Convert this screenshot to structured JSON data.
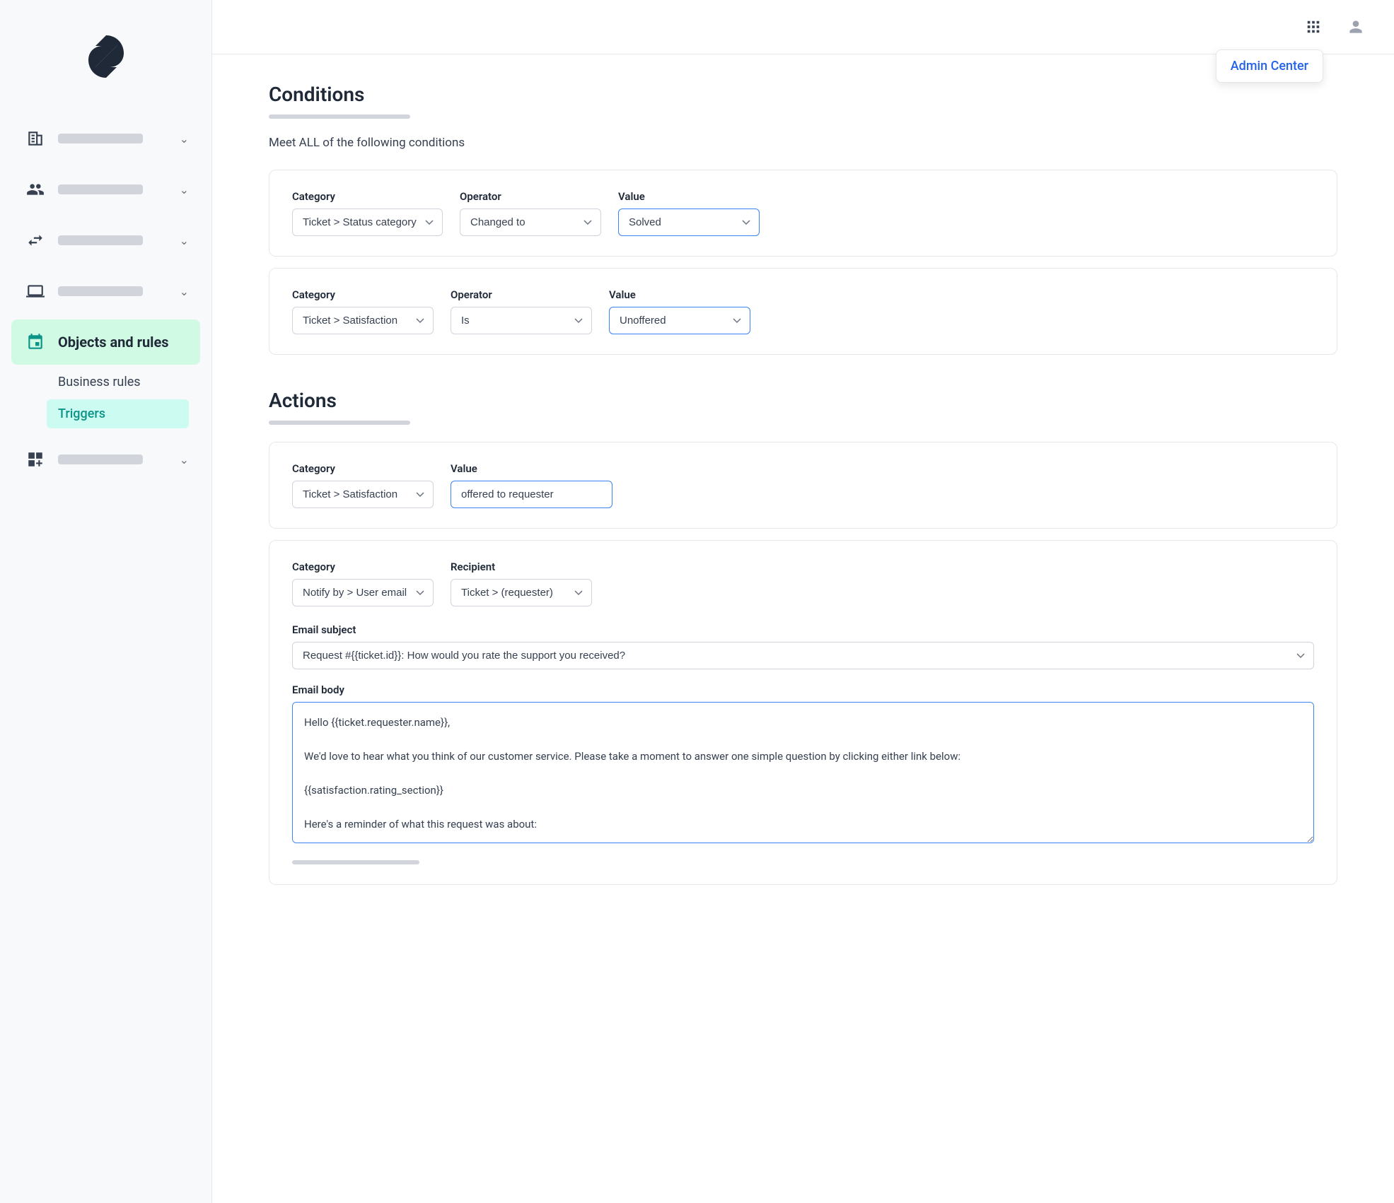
{
  "sidebar": {
    "logo_alt": "Zendesk",
    "nav_items": [
      {
        "id": "buildings",
        "label_bar": true,
        "active": false,
        "icon": "buildings"
      },
      {
        "id": "people",
        "label_bar": true,
        "active": false,
        "icon": "people"
      },
      {
        "id": "arrows",
        "label_bar": true,
        "active": false,
        "icon": "arrows"
      },
      {
        "id": "monitor",
        "label_bar": true,
        "active": false,
        "icon": "monitor"
      },
      {
        "id": "objects-rules",
        "label": "Objects and rules",
        "active": true,
        "icon": "objects"
      },
      {
        "id": "grid-plus",
        "label_bar": true,
        "active": false,
        "icon": "grid-plus"
      }
    ],
    "sub_items": [
      {
        "id": "business-rules",
        "label": "Business rules",
        "active": false
      },
      {
        "id": "triggers",
        "label": "Triggers",
        "active": true
      }
    ]
  },
  "header": {
    "admin_center_label": "Admin Center"
  },
  "conditions": {
    "title": "Conditions",
    "subtitle": "Meet ALL of the following conditions",
    "rows": [
      {
        "category_label": "Category",
        "operator_label": "Operator",
        "value_label": "Value",
        "category_value": "Ticket > Status category",
        "operator_value": "Changed to",
        "value_value": "Solved",
        "value_active": true
      },
      {
        "category_label": "Category",
        "operator_label": "Operator",
        "value_label": "Value",
        "category_value": "Ticket > Satisfaction",
        "operator_value": "Is",
        "value_value": "Unoffered",
        "value_active": true
      }
    ]
  },
  "actions": {
    "title": "Actions",
    "rows": [
      {
        "category_label": "Category",
        "value_label": "Value",
        "category_value": "Ticket > Satisfaction",
        "value_value": "offered to requester",
        "value_active": true
      }
    ],
    "notify_row": {
      "category_label": "Category",
      "recipient_label": "Recipient",
      "category_value": "Notify by > User email",
      "recipient_value": "Ticket > (requester)"
    },
    "email_subject_label": "Email subject",
    "email_subject_value": "Request #{{ticket.id}}: How would you rate the support you received?",
    "email_body_label": "Email body",
    "email_body_value": "Hello {{ticket.requester.name}},\n\nWe'd love to hear what you think of our customer service. Please take a moment to answer one simple question by clicking either link below:\n\n{{satisfaction.rating_section}}\n\nHere's a reminder of what this request was about:"
  }
}
